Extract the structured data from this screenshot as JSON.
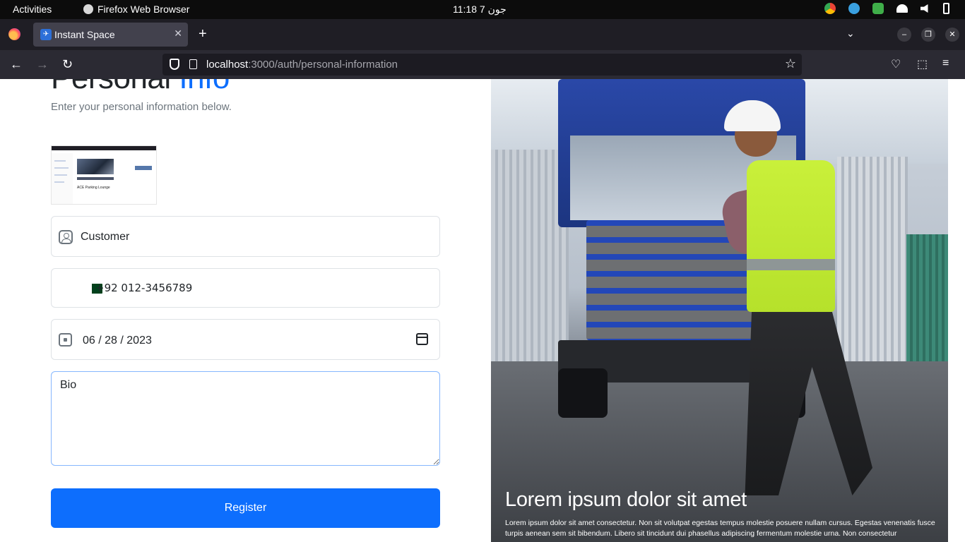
{
  "os_bar": {
    "activities": "Activities",
    "app_name": "Firefox Web Browser",
    "clock": "11:18  7 جون"
  },
  "browser": {
    "tab_title": "Instant Space",
    "url_host": "localhost",
    "url_path": ":3000/auth/personal-information"
  },
  "page": {
    "heading_part1": "Personal",
    "heading_part2": "Info",
    "subtitle": "Enter your personal information below.",
    "role_value": "Customer",
    "phone_value": "+92 012-3456789",
    "dob_value": "06 / 28 / 2023",
    "bio_placeholder": "Bio",
    "register_label": "Register",
    "thumbnail_title": "ACE Parking Lounge"
  },
  "hero": {
    "title": "Lorem ipsum dolor sit amet",
    "text": "Lorem ipsum dolor sit amet consectetur. Non sit volutpat egestas tempus molestie posuere nullam cursus. Egestas venenatis fusce turpis aenean sem sit bibendum. Libero sit tincidunt dui phasellus adipiscing fermentum molestie urna. Non consectetur"
  },
  "colors": {
    "accent": "#0d6efd",
    "text": "#212529",
    "muted": "#6c757d"
  }
}
